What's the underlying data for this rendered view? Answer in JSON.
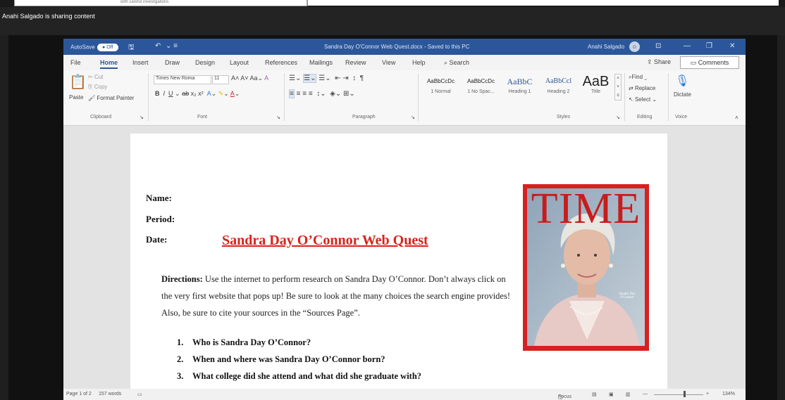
{
  "meeting": {
    "share_notice": "Anahi Salgado is sharing content",
    "top_strip_text": "with careful investigations"
  },
  "word": {
    "titlebar": {
      "autosave_label": "AutoSave",
      "autosave_state": "Off",
      "document_title": "Sandra Day O'Connor Web Quest.docx - Saved to this PC",
      "user_name": "Anahi Salgado"
    },
    "tabs": [
      "File",
      "Home",
      "Insert",
      "Draw",
      "Design",
      "Layout",
      "References",
      "Mailings",
      "Review",
      "View",
      "Help"
    ],
    "active_tab": "Home",
    "search_label": "Search",
    "share_label": "Share",
    "comments_label": "Comments",
    "ribbon": {
      "clipboard": {
        "paste": "Paste",
        "cut": "Cut",
        "copy": "Copy",
        "format_painter": "Format Painter",
        "label": "Clipboard"
      },
      "font": {
        "font_name": "Times New Roma",
        "font_size": "11",
        "label": "Font"
      },
      "paragraph": {
        "label": "Paragraph"
      },
      "styles": {
        "items": [
          {
            "preview": "AaBbCcDc",
            "name": "1 Normal"
          },
          {
            "preview": "AaBbCcDc",
            "name": "1 No Spac..."
          },
          {
            "preview": "AaBbC",
            "name": "Heading 1"
          },
          {
            "preview": "AaBbCcl",
            "name": "Heading 2"
          },
          {
            "preview": "AaB",
            "name": "Title"
          }
        ],
        "label": "Styles"
      },
      "editing": {
        "find": "Find",
        "replace": "Replace",
        "select": "Select",
        "label": "Editing"
      },
      "voice": {
        "dictate": "Dictate",
        "label": "Voice"
      }
    },
    "document": {
      "name_label": "Name:",
      "period_label": "Period:",
      "date_label": "Date:",
      "title": "Sandra Day O’Connor Web Quest",
      "directions_label": "Directions:",
      "directions_text": "Use the internet to perform research on Sandra Day O’Connor. Don’t always click on the very first website that pops up! Be sure to look at the many choices the search engine provides! Also, be sure to cite your sources in the “Sources Page”.",
      "questions": [
        {
          "num": "1.",
          "text": "Who is Sandra Day O’Connor?"
        },
        {
          "num": "2.",
          "text": "When and where was Sandra Day O’Connor born?"
        },
        {
          "num": "3.",
          "text": "What college did she attend and what did she graduate with?"
        }
      ],
      "cover_masthead": "TIME",
      "cover_caption": "Sandra Day O'Connor"
    },
    "statusbar": {
      "page": "Page 1 of 2",
      "words": "157 words",
      "focus": "Focus",
      "zoom": "134%"
    }
  },
  "colors": {
    "word_blue": "#2b579a",
    "title_red": "#d9221e",
    "cover_red": "#d92020"
  }
}
